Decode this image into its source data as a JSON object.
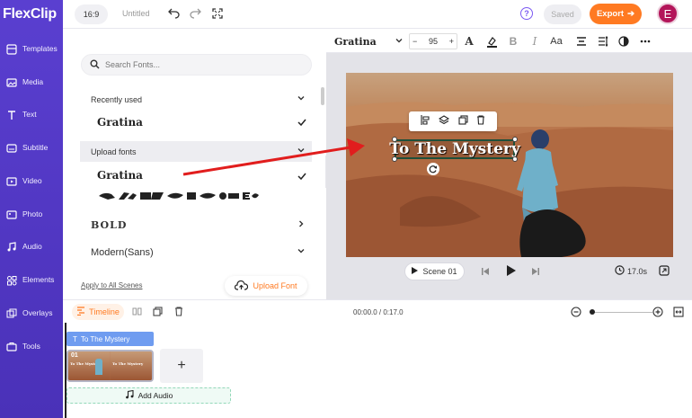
{
  "brand": {
    "logo": "FlexClip",
    "accent": "#ff7a22",
    "nav_bg": "#5a3fd0"
  },
  "nav": {
    "items": [
      {
        "label": "Templates",
        "icon": "templates-icon"
      },
      {
        "label": "Media",
        "icon": "media-icon"
      },
      {
        "label": "Text",
        "icon": "text-icon"
      },
      {
        "label": "Subtitle",
        "icon": "subtitle-icon"
      },
      {
        "label": "Video",
        "icon": "video-icon"
      },
      {
        "label": "Photo",
        "icon": "photo-icon"
      },
      {
        "label": "Audio",
        "icon": "audio-icon"
      },
      {
        "label": "Elements",
        "icon": "elements-icon"
      },
      {
        "label": "Overlays",
        "icon": "overlays-icon"
      },
      {
        "label": "Tools",
        "icon": "tools-icon"
      }
    ]
  },
  "topbar": {
    "ratio": "16:9",
    "project_name": "Untitled",
    "saved": "Saved",
    "export": "Export",
    "avatar_initial": "E"
  },
  "font_panel": {
    "search_placeholder": "Search Fonts...",
    "recent_header": "Recently used",
    "recent_font": "Gratina",
    "upload_header": "Upload fonts",
    "upload_font": "Gratina",
    "font_bold": "BOLD",
    "font_modern": "Modern(Sans)",
    "apply_all": "Apply to All Scenes",
    "upload_font_btn": "Upload Font"
  },
  "text_toolbar": {
    "font": "Gratina",
    "size": "95",
    "case_label": "Aa"
  },
  "canvas": {
    "text": "To The Mystery"
  },
  "scene_bar": {
    "scene": "Scene 01",
    "duration": "17.0s"
  },
  "timeline": {
    "tab": "Timeline",
    "timecode": "00:00.0 / 0:17.0",
    "text_clip": "To The Mystery",
    "clip_number": "01",
    "thumb_text_a": "To The Mystery",
    "thumb_text_b": "To The Mystery",
    "add_audio": "Add Audio"
  }
}
